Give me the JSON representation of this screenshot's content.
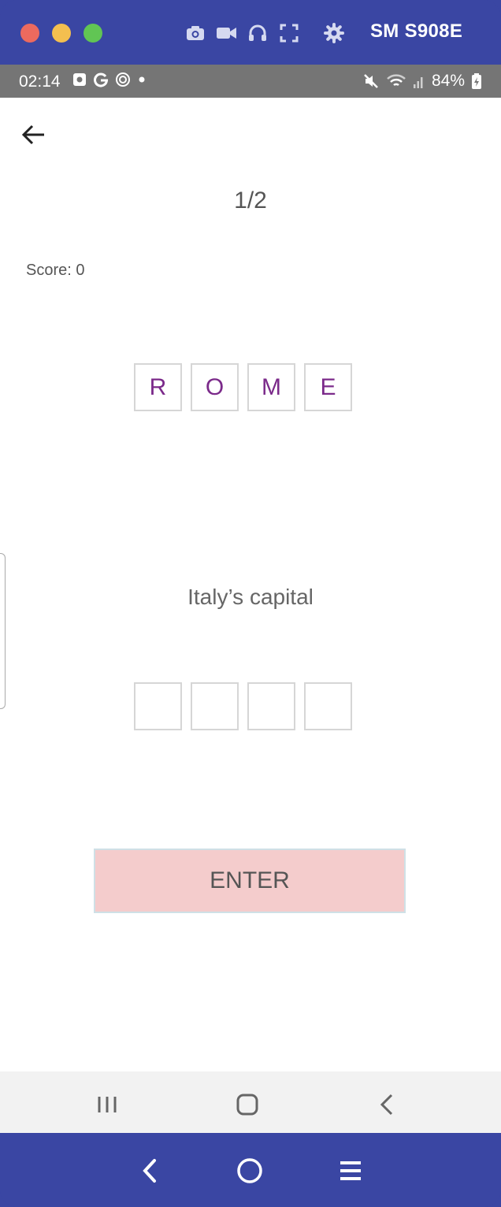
{
  "emulator": {
    "device_name": "SM S908E",
    "toolbar_icons": [
      "camera-icon",
      "video-icon",
      "headphones-icon",
      "fullscreen-icon",
      "gear-icon"
    ],
    "bottom_controls": [
      "back-chevron-icon",
      "home-circle-icon",
      "menu-icon"
    ]
  },
  "status_bar": {
    "time": "02:14",
    "left_icons": [
      "notification-square-icon",
      "google-g-icon",
      "target-icon",
      "dot-icon"
    ],
    "battery": "84%",
    "right_icons": [
      "mute-icon",
      "wifi-icon",
      "signal-icon",
      "battery-icon"
    ]
  },
  "app": {
    "progress": "1/2",
    "score": "Score: 0",
    "word_tiles": [
      "R",
      "O",
      "M",
      "E"
    ],
    "clue": "Italy’s capital",
    "answer_tiles": [
      "",
      "",
      "",
      ""
    ],
    "enter_label": "ENTER",
    "colors": {
      "tile_letter": "#7b2a8a",
      "enter_bg": "#f4cccc",
      "frame": "#3a46a3"
    }
  },
  "android_nav": [
    "recents-icon",
    "home-icon",
    "back-icon"
  ]
}
